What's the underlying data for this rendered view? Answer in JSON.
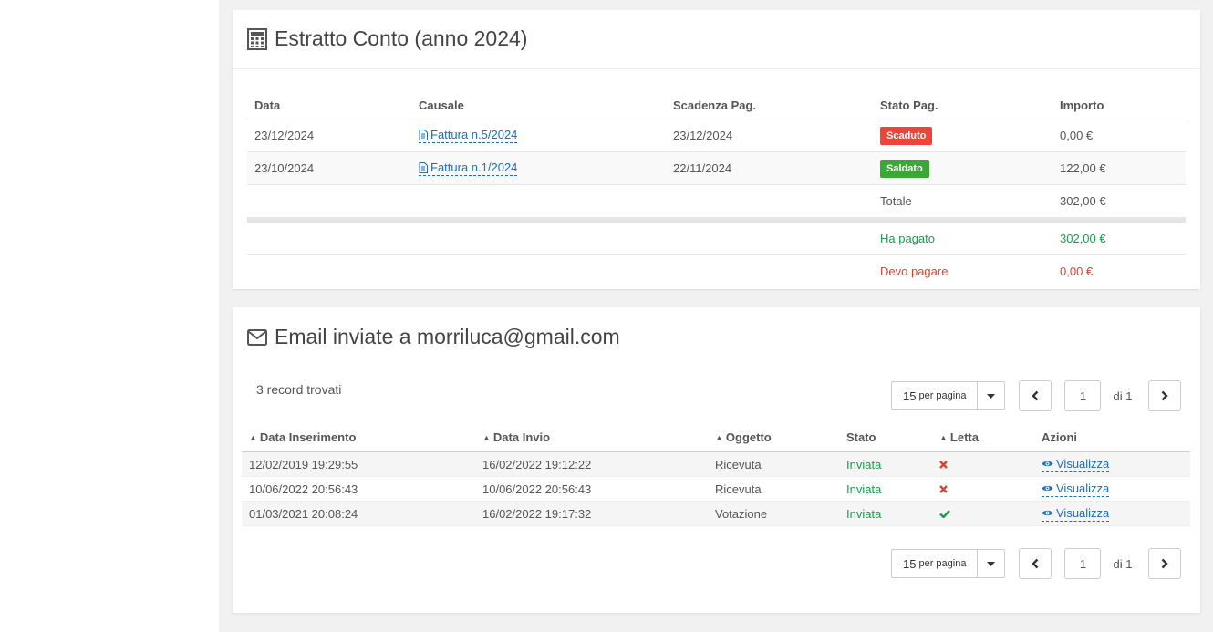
{
  "statement": {
    "title": "Estratto Conto (anno 2024)",
    "columns": [
      "Data",
      "Causale",
      "Scadenza Pag.",
      "Stato Pag.",
      "Importo"
    ],
    "rows": [
      {
        "data": "23/12/2024",
        "causale": "Fattura n.5/2024",
        "scadenza": "23/12/2024",
        "stato": "Scaduto",
        "stato_color": "#f0443b",
        "importo": "0,00 €"
      },
      {
        "data": "23/10/2024",
        "causale": "Fattura n.1/2024",
        "scadenza": "22/11/2024",
        "stato": "Saldato",
        "stato_color": "#3aa835",
        "importo": "122,00 €"
      }
    ],
    "totale_label": "Totale",
    "totale_value": "302,00 €",
    "ha_pagato_label": "Ha pagato",
    "ha_pagato_value": "302,00 €",
    "devo_pagare_label": "Devo pagare",
    "devo_pagare_value": "0,00 €"
  },
  "emails": {
    "title": "Email inviate a morriluca@gmail.com",
    "records_found": "3 record trovati",
    "pager": {
      "per_page_num": "15",
      "per_page_label": "per pagina",
      "page": "1",
      "of": "di 1"
    },
    "columns": [
      "Data Inserimento",
      "Data Invio",
      "Oggetto",
      "Stato",
      "Letta",
      "Azioni"
    ],
    "rows": [
      {
        "inserimento": "12/02/2019 19:29:55",
        "invio": "16/02/2022 19:12:22",
        "oggetto": "Ricevuta",
        "stato": "Inviata",
        "letta": "cross-icon",
        "azione": "Visualizza"
      },
      {
        "inserimento": "10/06/2022 20:56:43",
        "invio": "10/06/2022 20:56:43",
        "oggetto": "Ricevuta",
        "stato": "Inviata",
        "letta": "cross-icon",
        "azione": "Visualizza"
      },
      {
        "inserimento": "01/03/2021 20:08:24",
        "invio": "16/02/2022 19:17:32",
        "oggetto": "Votazione",
        "stato": "Inviata",
        "letta": "check-icon",
        "azione": "Visualizza"
      }
    ]
  },
  "colors": {
    "link": "#1a6dbf",
    "success": "#12a04b",
    "danger": "#d9432e"
  }
}
